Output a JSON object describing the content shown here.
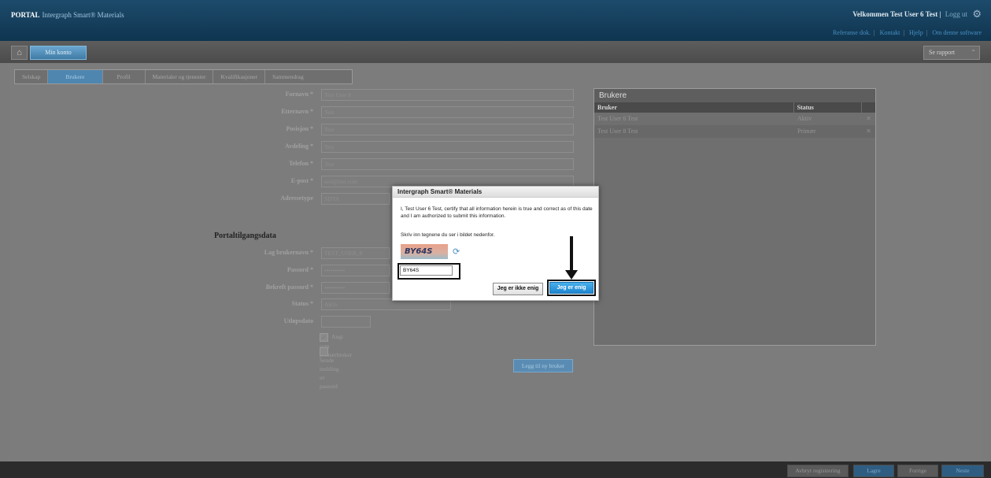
{
  "header": {
    "brand": "PORTAL",
    "product": "Intergraph Smart® Materials",
    "welcome": "Velkommen Test User 6 Test",
    "logout": "Logg ut",
    "links": [
      "Referanse dok.",
      "Kontakt",
      "Hjelp",
      "Om denne software"
    ]
  },
  "toolbar": {
    "active_tab": "Min konto",
    "report_select": "Se rapport"
  },
  "breadcrumb": [
    "Selskap",
    "Brukere",
    "Profil",
    "Materialer og tjenester",
    "Kvalifikasjoner",
    "Sammendrag"
  ],
  "breadcrumb_active": "Brukere",
  "form": {
    "fornavn": {
      "label": "Fornavn",
      "value": "Test User 8"
    },
    "etternavn": {
      "label": "Etternavn",
      "value": "Test"
    },
    "posisjon": {
      "label": "Posisjon",
      "value": "Test"
    },
    "avdeling": {
      "label": "Avdeling",
      "value": "Test"
    },
    "telefon": {
      "label": "Telefon",
      "value": "Test"
    },
    "epost": {
      "label": "E-post",
      "value": "test@test.com"
    },
    "adressetype": {
      "label": "Adressetype",
      "value": "SDTA"
    },
    "section_title": "Portaltilgangsdata",
    "brukernavn": {
      "label": "Lag brukernavn",
      "value": "TEST_USER_8"
    },
    "passord": {
      "label": "Passord",
      "value": "••••••••••"
    },
    "bekreft": {
      "label": "Bekreft passord",
      "value": "••••••••••"
    },
    "status": {
      "label": "Status",
      "value": "Aktiv"
    },
    "utlopsdato": {
      "label": "Utløpsdato",
      "value": ""
    },
    "cb1": "Angi som primærbruker",
    "cb2": "Sende melding av passord",
    "add_user": "Legg til ny bruker"
  },
  "brukere": {
    "title": "Brukere",
    "col_user": "Bruker",
    "col_status": "Status",
    "rows": [
      {
        "user": "Test User 6 Test",
        "status": "Aktiv"
      },
      {
        "user": "Test User 8 Test",
        "status": "Primær"
      }
    ]
  },
  "footer": {
    "cancel": "Avbryt registrering",
    "save": "Lagre",
    "prev": "Forrige",
    "next": "Neste"
  },
  "dialog": {
    "title": "Intergraph Smart® Materials",
    "text": "I, Test User 6 Test, certify that all information herein is true and correct as of this date and I am authorized to submit this information.",
    "instruction": "Skriv inn tegnene du ser i bildet nedenfor.",
    "captcha_text": "BY64S",
    "captcha_input": "BY64S",
    "disagree": "Jeg er ikke enig",
    "agree": "Jeg er enig"
  },
  "colors": {
    "header_bg": "#1d4b6b",
    "accent_blue": "#1f86cf",
    "overlay_grey": "#7b7b7b"
  }
}
